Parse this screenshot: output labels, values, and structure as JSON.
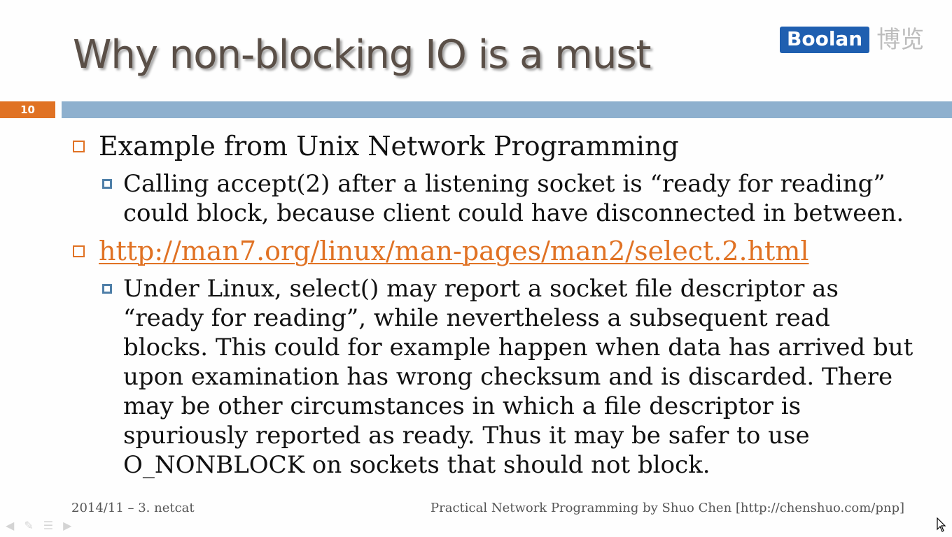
{
  "slide": {
    "title": "Why non-blocking IO is a must",
    "page_number": "10",
    "logo": {
      "brand": "Boolan",
      "chinese": "博览"
    },
    "bullets": [
      {
        "text": "Example from Unix Network Programming",
        "sub": "Calling accept(2) after a listening socket is “ready for reading” could block, because client could have disconnected in between."
      },
      {
        "link": "http://man7.org/linux/man-pages/man2/select.2.html",
        "sub": "Under Linux, select() may report a socket file descriptor as “ready for reading”, while nevertheless a subsequent read blocks. This could for example happen when data has arrived but upon examination has wrong checksum and is discarded. There may be other circumstances in which a file descriptor is spuriously reported as ready. Thus it may be safer to use O_NONBLOCK on sockets that should not block."
      }
    ],
    "footer": {
      "left": "2014/11 – 3. netcat",
      "right": "Practical Network Programming by Shuo Chen [http://chenshuo.com/pnp]"
    }
  },
  "icons": {
    "controls": [
      "prev-arrow-icon",
      "pen-icon",
      "menu-icon",
      "next-arrow-icon"
    ],
    "cursor": "mouse-pointer-icon"
  },
  "colors": {
    "accent_orange": "#e07224",
    "bar_blue": "#8eb0ce",
    "logo_blue": "#1f5fb0",
    "sub_bullet_blue": "#4f7fa8"
  }
}
